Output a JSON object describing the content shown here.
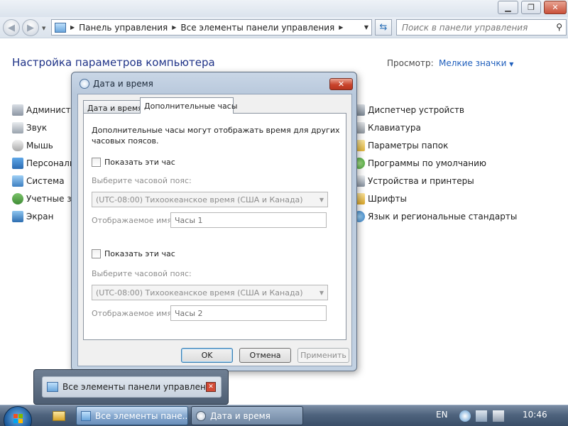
{
  "explorer": {
    "address_segments": [
      "Панель управления",
      "Все элементы панели управления"
    ],
    "search_placeholder": "Поиск в панели управления",
    "page_title": "Настройка параметров компьютера",
    "view_label": "Просмотр:",
    "view_value": "Мелкие значки",
    "left_items": [
      {
        "label": "Администр",
        "icon": "admin-tools-icon"
      },
      {
        "label": "Звук",
        "icon": "speaker-icon"
      },
      {
        "label": "Мышь",
        "icon": "mouse-icon"
      },
      {
        "label": "Персонали",
        "icon": "personalization-icon"
      },
      {
        "label": "Система",
        "icon": "system-icon"
      },
      {
        "label": "Учетные за",
        "icon": "user-accounts-icon"
      },
      {
        "label": "Экран",
        "icon": "display-icon"
      }
    ],
    "right_items": [
      {
        "label": "Диспетчер устройств",
        "icon": "device-manager-icon"
      },
      {
        "label": "Клавиатура",
        "icon": "keyboard-icon"
      },
      {
        "label": "Параметры папок",
        "icon": "folder-options-icon"
      },
      {
        "label": "Программы по умолчанию",
        "icon": "default-programs-icon"
      },
      {
        "label": "Устройства и принтеры",
        "icon": "printer-icon"
      },
      {
        "label": "Шрифты",
        "icon": "fonts-icon"
      },
      {
        "label": "Язык и региональные стандарты",
        "icon": "region-icon"
      }
    ]
  },
  "dialog": {
    "title": "Дата и время",
    "tabs": [
      "Дата и время",
      "Дополнительные часы"
    ],
    "active_tab": "Дополнительные часы",
    "description": "Дополнительные часы могут отображать время для других часовых поясов.",
    "clocks": [
      {
        "checkbox_label": "Показать эти час",
        "checked": false,
        "timezone_label": "Выберите часовой пояс:",
        "timezone_value": "(UTC-08:00) Тихоокеанское время (США и Канада)",
        "name_label": "Отображаемое имя:",
        "name_value": "Часы 1"
      },
      {
        "checkbox_label": "Показать эти час",
        "checked": false,
        "timezone_label": "Выберите часовой пояс:",
        "timezone_value": "(UTC-08:00) Тихоокеанское время (США и Канада)",
        "name_label": "Отображаемое имя:",
        "name_value": "Часы 2"
      }
    ],
    "buttons": {
      "ok": "OK",
      "cancel": "Отмена",
      "apply": "Применить"
    }
  },
  "thumbnail": {
    "label": "Все элементы панели управления"
  },
  "taskbar": {
    "buttons": [
      {
        "label": "Все элементы пане...",
        "active": true
      },
      {
        "label": "Дата и время",
        "active": false
      }
    ],
    "language": "EN",
    "clock": "10:46"
  }
}
